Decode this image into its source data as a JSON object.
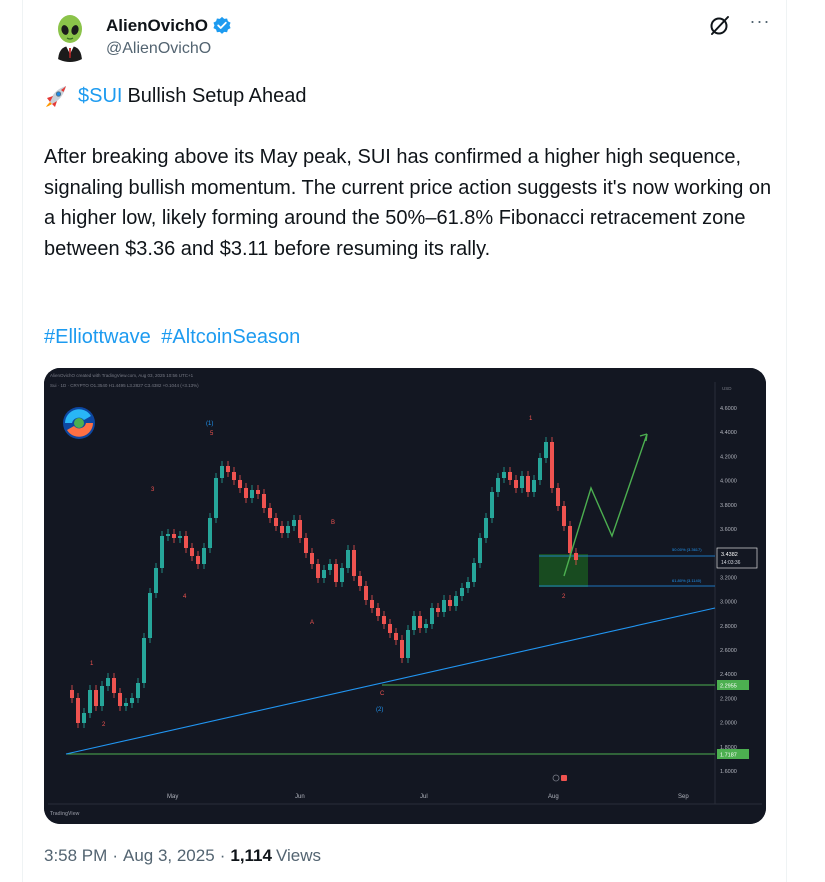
{
  "author": {
    "display_name": "AlienOvichO",
    "handle": "@AlienOvichO",
    "verified": true
  },
  "tweet": {
    "title_icon": "rocket-emoji",
    "cashtag": "$SUI",
    "title_rest": "Bullish Setup Ahead",
    "body": "After breaking above its May peak, SUI has confirmed a higher high sequence, signaling bullish momentum. The current price action suggests it's now working on a higher low, likely forming around the 50%–61.8% Fibonacci retracement zone between $3.36 and $3.11 before resuming its rally.",
    "hashtags": [
      "#Elliottwave",
      "#AltcoinSeason"
    ]
  },
  "chart": {
    "header_line": "AlienOvichO created with TradingView.com, Aug 03, 2025 10:56 UTC+1",
    "symbol_line": "Sui · 1D · CRYPTO  O1.3540  H1.4495  L3.2827  C3.4382  +0.1044 (+3.13%)",
    "currency": "USD",
    "price_ticks": [
      "4.6000",
      "4.4000",
      "4.2000",
      "4.0000",
      "3.8000",
      "3.6000",
      "3.4000",
      "3.2000",
      "3.0000",
      "2.8000",
      "2.6000",
      "2.4000",
      "2.2000",
      "2.0000",
      "1.8000",
      "1.6000"
    ],
    "month_labels": [
      "May",
      "Jun",
      "Jul",
      "Aug",
      "Sep"
    ],
    "current_price": "3.4382",
    "countdown": "14:03:36",
    "fib_50_label": "50.00% (3.3617)",
    "fib_618_label": "61.80% (3.1140)",
    "level_high": "2.2955",
    "level_low": "1.7187",
    "wave_labels": {
      "w1": "1",
      "w2": "2",
      "w3": "3",
      "w4": "4",
      "w5": "5",
      "wave1": "(1)",
      "a": "A",
      "b": "B",
      "c": "C",
      "wave2": "(2)",
      "n1": "1",
      "n2": "2"
    },
    "watermark": "TradingView",
    "colors": {
      "background": "#131722",
      "bull": "#26a69a",
      "bear": "#ef5350",
      "trendline": "#2196f3",
      "projection": "#4caf50",
      "fib_zone": "#1b5e20",
      "level_line": "#4caf50"
    }
  },
  "meta": {
    "time": "3:58 PM",
    "date": "Aug 3, 2025",
    "views_count": "1,114",
    "views_label": "Views"
  }
}
